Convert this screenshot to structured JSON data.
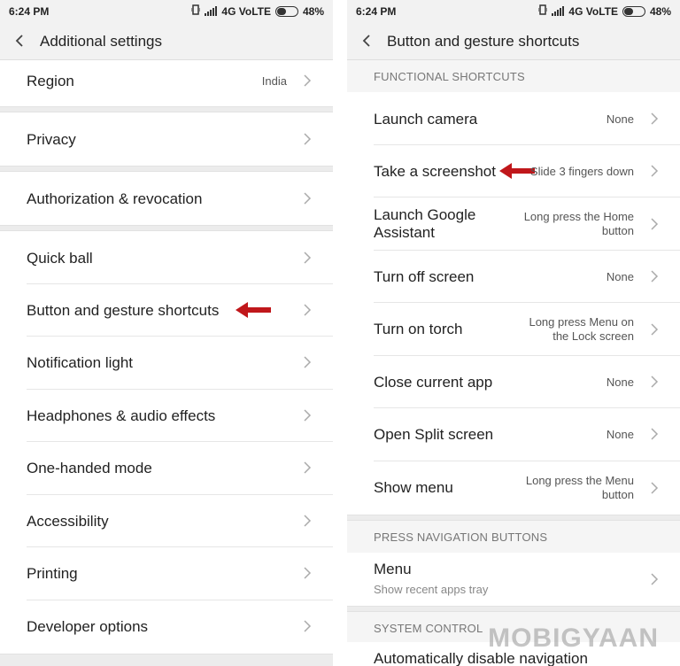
{
  "left_screen": {
    "status": {
      "time": "6:24 PM",
      "network": "4G VoLTE",
      "battery": "48%",
      "battery_level": 0.48
    },
    "header": {
      "title": "Additional settings"
    },
    "items": [
      {
        "label": "Region",
        "value": "India"
      },
      {
        "label": "Privacy"
      },
      {
        "label": "Authorization & revocation"
      },
      {
        "label": "Quick ball"
      },
      {
        "label": "Button and gesture shortcuts"
      },
      {
        "label": "Notification light"
      },
      {
        "label": "Headphones & audio effects"
      },
      {
        "label": "One-handed mode"
      },
      {
        "label": "Accessibility"
      },
      {
        "label": "Printing"
      },
      {
        "label": "Developer options"
      }
    ]
  },
  "right_screen": {
    "status": {
      "time": "6:24 PM",
      "network": "4G VoLTE",
      "battery": "48%",
      "battery_level": 0.48
    },
    "header": {
      "title": "Button and gesture shortcuts"
    },
    "functional_shortcuts": {
      "heading": "FUNCTIONAL SHORTCUTS",
      "items": [
        {
          "label": "Launch camera",
          "value": "None"
        },
        {
          "label": "Take a screenshot",
          "value": "Slide 3 fingers down"
        },
        {
          "label_line1": "Launch Google",
          "label_line2": "Assistant",
          "value_line1": "Long press the Home",
          "value_line2": "button"
        },
        {
          "label": "Turn off screen",
          "value": "None"
        },
        {
          "label": "Turn on torch",
          "value_line1": "Long press Menu on",
          "value_line2": "the Lock screen"
        },
        {
          "label": "Close current app",
          "value": "None"
        },
        {
          "label": "Open Split screen",
          "value": "None"
        },
        {
          "label": "Show menu",
          "value_line1": "Long press the Menu",
          "value_line2": "button"
        }
      ]
    },
    "press_navigation": {
      "heading": "PRESS NAVIGATION BUTTONS",
      "items": [
        {
          "label": "Menu",
          "subtitle": "Show recent apps tray"
        }
      ]
    },
    "system_control": {
      "heading": "SYSTEM CONTROL",
      "items": [
        {
          "label": "Automatically disable navigation"
        }
      ]
    }
  },
  "watermark": "MOBIGYAAN",
  "colors": {
    "arrow": "#c0171b",
    "background": "#f2f2f2",
    "row": "#ffffff",
    "separator": "#e6e6e6"
  }
}
